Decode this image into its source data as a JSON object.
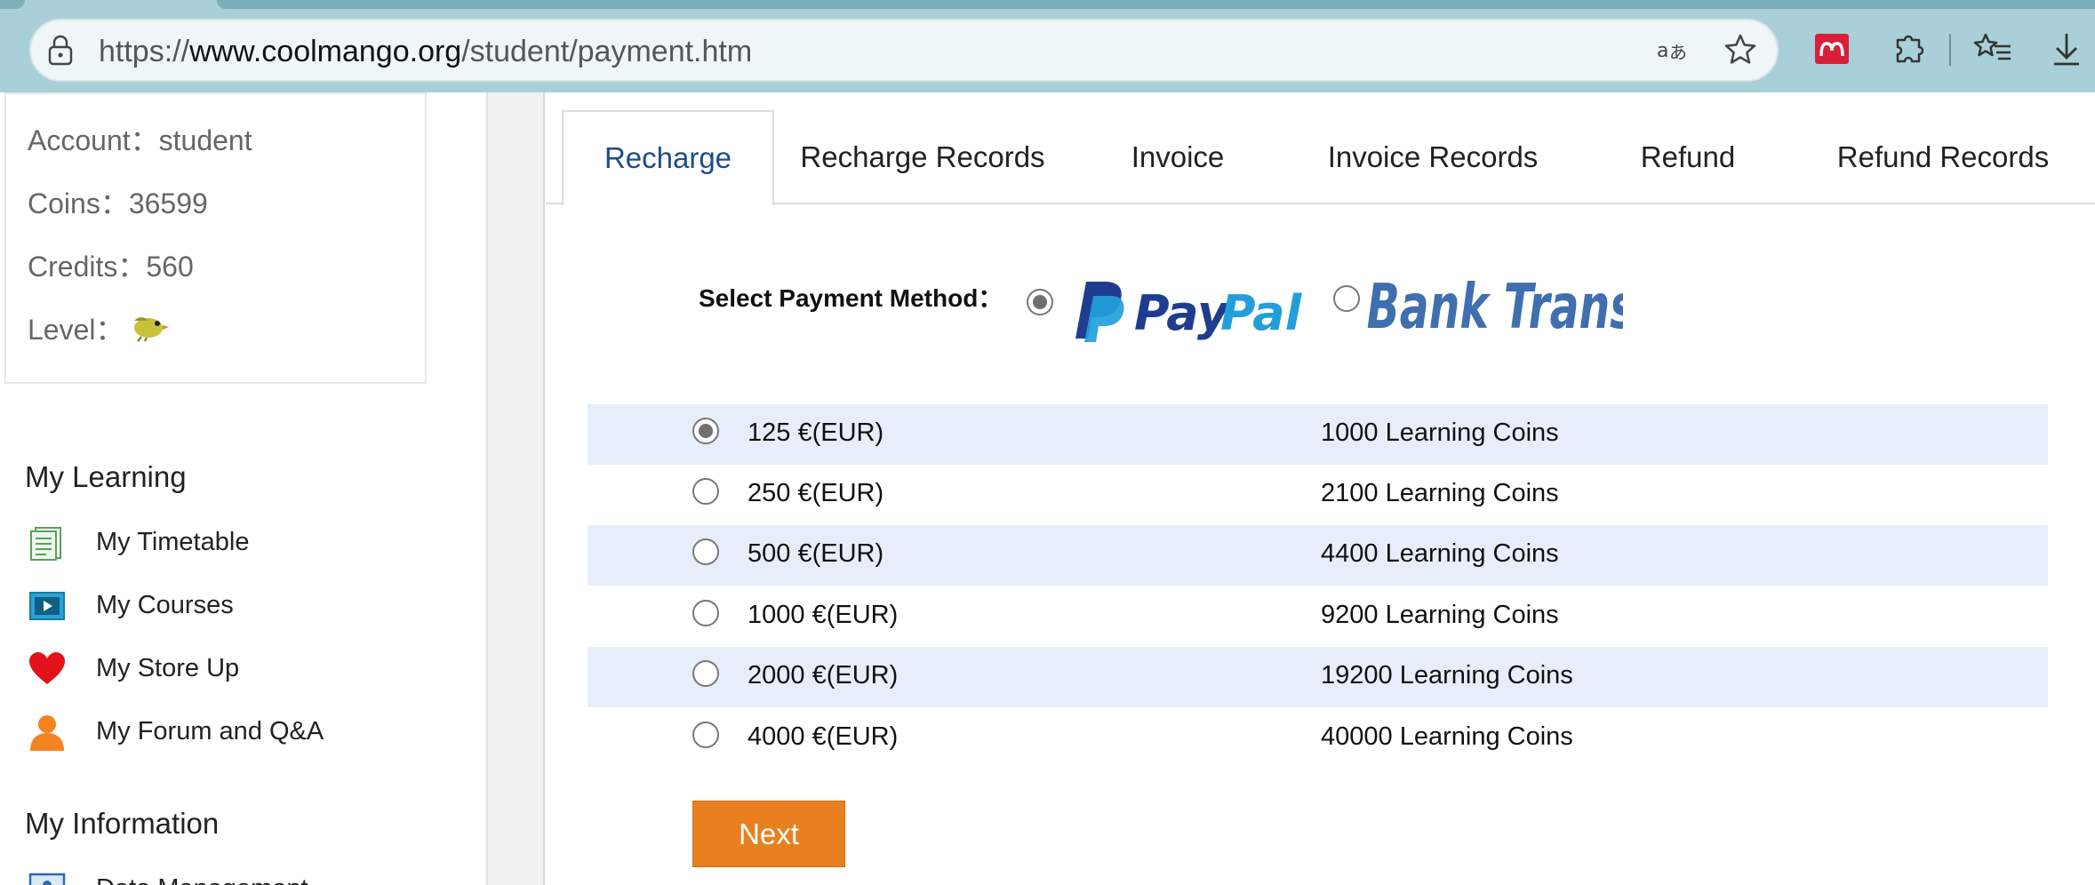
{
  "browser": {
    "url_prefix": "https://",
    "url_domain": "www.coolmango.org",
    "url_path": "/student/payment.htm"
  },
  "profile": {
    "account": "Account：student",
    "coins": "Coins：36599",
    "credits": "Credits：560",
    "level": "Level："
  },
  "sidebar": {
    "my_learning_title": "My Learning",
    "learning_items": [
      {
        "label": "My Timetable",
        "icon": "timetable-icon"
      },
      {
        "label": "My Courses",
        "icon": "courses-icon"
      },
      {
        "label": "My Store Up",
        "icon": "heart-icon"
      },
      {
        "label": "My Forum and Q&A",
        "icon": "person-icon"
      }
    ],
    "my_information_title": "My Information",
    "info_items": [
      {
        "label": "Data Management",
        "icon": "id-card-icon"
      }
    ]
  },
  "tabs": [
    {
      "label": "Recharge",
      "active": true
    },
    {
      "label": "Recharge Records"
    },
    {
      "label": "Invoice"
    },
    {
      "label": "Invoice Records"
    },
    {
      "label": "Refund"
    },
    {
      "label": "Refund Records"
    }
  ],
  "payment": {
    "select_label": "Select Payment Method：",
    "methods": [
      {
        "name": "PayPal",
        "selected": true
      },
      {
        "name": "Bank Transfer",
        "selected": false
      }
    ]
  },
  "options": [
    {
      "price": "125 €(EUR)",
      "coins": "1000 Learning Coins",
      "selected": true
    },
    {
      "price": "250 €(EUR)",
      "coins": "2100 Learning Coins"
    },
    {
      "price": "500 €(EUR)",
      "coins": "4400 Learning Coins"
    },
    {
      "price": "1000 €(EUR)",
      "coins": "9200 Learning Coins"
    },
    {
      "price": "2000 €(EUR)",
      "coins": "19200 Learning Coins"
    },
    {
      "price": "4000 €(EUR)",
      "coins": "40000 Learning Coins"
    }
  ],
  "next_label": "Next",
  "colors": {
    "accent_button": "#e8801f",
    "active_tab_text": "#1f4c88",
    "row_shade": "#e8eef9",
    "browser_frame": "#a9d0d8"
  }
}
